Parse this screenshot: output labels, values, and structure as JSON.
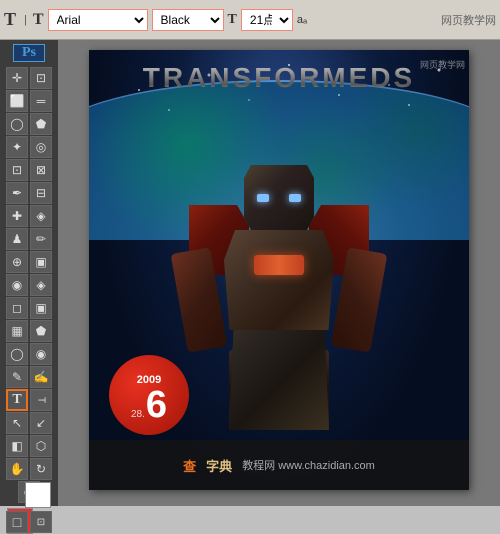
{
  "toolbar": {
    "t_icon": "T",
    "font_label": "Arial",
    "style_label": "Black",
    "size_label": "21点",
    "t2_icon": "T",
    "aa_label": "aₐ",
    "site_watermark": "网页教学网"
  },
  "canvas": {
    "title": "TRANSFORMEDS",
    "badge": {
      "year": "2009",
      "number": "6",
      "sub": "28."
    }
  },
  "bottombar": {
    "logo": "查",
    "name": "字典",
    "domain": "教程网  www.chazidian.com"
  },
  "tools": {
    "items": [
      {
        "name": "move",
        "icon": "✛"
      },
      {
        "name": "marquee",
        "icon": "⬜"
      },
      {
        "name": "lasso",
        "icon": "○"
      },
      {
        "name": "magic-wand",
        "icon": "✦"
      },
      {
        "name": "crop",
        "icon": "⊡"
      },
      {
        "name": "eyedropper",
        "icon": "✒"
      },
      {
        "name": "healing",
        "icon": "✚"
      },
      {
        "name": "brush",
        "icon": "♟"
      },
      {
        "name": "clone",
        "icon": "⊕"
      },
      {
        "name": "history",
        "icon": "◉"
      },
      {
        "name": "eraser",
        "icon": "◻"
      },
      {
        "name": "gradient",
        "icon": "▦"
      },
      {
        "name": "dodge",
        "icon": "◯"
      },
      {
        "name": "pen",
        "icon": "✎"
      },
      {
        "name": "text",
        "icon": "T"
      },
      {
        "name": "shape",
        "icon": "◧"
      },
      {
        "name": "path",
        "icon": "↖"
      },
      {
        "name": "3d",
        "icon": "⬡"
      },
      {
        "name": "hand",
        "icon": "✋"
      },
      {
        "name": "zoom",
        "icon": "⊕"
      }
    ]
  }
}
